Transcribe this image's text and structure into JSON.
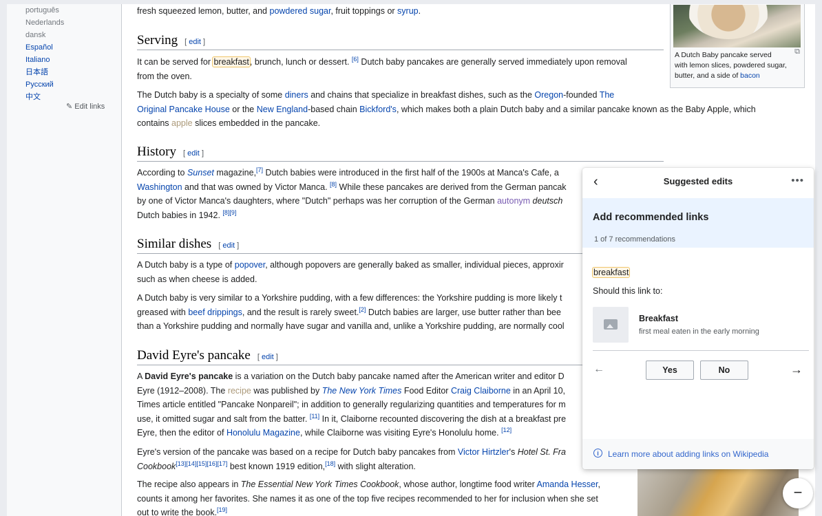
{
  "sidebar": {
    "languages": [
      "português",
      "Nederlands",
      "dansk",
      "Español",
      "Italiano",
      "日本語",
      "Русский",
      "中文"
    ],
    "edit_links": "Edit links"
  },
  "article": {
    "intro_tail": {
      "a": "fresh squeezed lemon, butter, and ",
      "link1": "powdered sugar",
      "b": ", fruit toppings or ",
      "link2": "syrup",
      "c": "."
    },
    "edit_label": "edit",
    "serving": {
      "heading": "Serving",
      "p1": {
        "a": "It can be served for ",
        "hl": "breakfast",
        "b": ", brunch, lunch or dessert.",
        "ref": "[6]",
        "c": " Dutch baby pancakes are generally served immediately upon removal",
        "line2": "from the oven."
      },
      "p2": {
        "a": "The Dutch baby is a specialty of some ",
        "l1": "diners",
        "b": " and chains that specialize in breakfast dishes, such as the ",
        "l2": "Oregon",
        "c": "-founded ",
        "l3": "The",
        "l3b": "Original Pancake House",
        "d": " or the ",
        "l4": "New England",
        "e": "-based chain ",
        "l5": "Bickford's",
        "f": ", which makes both a plain Dutch baby and a similar pancake known as the Baby Apple, which",
        "g": "contains ",
        "l6": "apple",
        "h": " slices embedded in the pancake."
      }
    },
    "history": {
      "heading": "History",
      "line1": {
        "a": "According to ",
        "l1": "Sunset",
        "b": " magazine,",
        "ref": "[7]",
        "c": " Dutch babies were introduced in the first half of the 1900s at Manca's Cafe, a"
      },
      "line2": {
        "l1": "Washington",
        "a": " and that was owned by Victor Manca.",
        "ref": "[8]",
        "b": " While these pancakes are derived from the German pancak"
      },
      "line3": {
        "a": "by one of Victor Manca's daughters, where \"Dutch\" perhaps was her corruption of the German ",
        "l1": "autonym",
        "b": " deutsch"
      },
      "line4": {
        "a": "Dutch babies in 1942.",
        "ref": "[8][9]"
      }
    },
    "similar": {
      "heading": "Similar dishes",
      "p1": {
        "a": "A Dutch baby is a type of ",
        "l1": "popover",
        "b": ", although popovers are generally baked as smaller, individual pieces, approxir",
        "line2": "such as when cheese is added."
      },
      "p2": {
        "line1": "A Dutch baby is very similar to a Yorkshire pudding, with a few differences: the Yorkshire pudding is more likely t",
        "a": "greased with ",
        "l1": "beef drippings",
        "b": ", and the result is rarely sweet.",
        "ref": "[2]",
        "c": " Dutch babies are larger, use butter rather than bee",
        "line3": "than a Yorkshire pudding and normally have sugar and vanilla and, unlike a Yorkshire pudding, are normally cool"
      }
    },
    "eyre": {
      "heading": "David Eyre's pancake",
      "p1": {
        "a": "A ",
        "bold": "David Eyre's pancake",
        "b": " is a variation on the Dutch baby pancake named after the American writer and editor D",
        "c": "Eyre (1912–2008). The ",
        "l1": "recipe",
        "d": " was published by ",
        "l2": "The New York Times",
        "e": " Food Editor ",
        "l3": "Craig Claiborne",
        "f": " in an April 10,",
        "g": "Times article entitled \"Pancake Nonpareil\"; in addition to generally regularizing quantities and temperatures for m",
        "h": "use, it omitted sugar and salt from the batter.",
        "ref1": "[11]",
        "i": " In it, Claiborne recounted discovering the dish at a breakfast pre",
        "j": "Eyre, then the editor of ",
        "l4": "Honolulu Magazine",
        "k": ", while Claiborne was visiting Eyre's Honolulu home.",
        "ref2": "[12]"
      },
      "p2": {
        "a": "Eyre's version of the pancake was based on a recipe for Dutch baby pancakes from ",
        "l1": "Victor Hirtzler",
        "b": "'s ",
        "it": "Hotel St. Fra",
        "it2": "Cookbook",
        "ref1": "[13][14][15][16][17]",
        "c": " best known 1919 edition,",
        "ref2": "[18]",
        "d": " with slight alteration."
      },
      "p3": {
        "a": "The recipe also appears in ",
        "it": "The Essential New York Times Cookbook",
        "b": ", whose author, longtime food writer ",
        "l1": "Amanda Hesser",
        "c": ",",
        "line2": "counts it among her favorites. She names it as one of the top five recipes recommended to her for inclusion when she set",
        "d": "out to write the book.",
        "ref": "[19]"
      }
    },
    "figure": {
      "caption_a": "A Dutch Baby pancake served",
      "caption_b": "with lemon slices, powdered sugar,",
      "caption_c": "butter, and a side of ",
      "caption_link": "bacon"
    }
  },
  "panel": {
    "title": "Suggested edits",
    "heading": "Add recommended links",
    "progress": "1 of 7 recommendations",
    "phrase": "breakfast",
    "question": "Should this link to:",
    "target_title": "Breakfast",
    "target_desc": "first meal eaten in the early morning",
    "yes": "Yes",
    "no": "No",
    "learn_more": "Learn more about adding links on Wikipedia"
  }
}
